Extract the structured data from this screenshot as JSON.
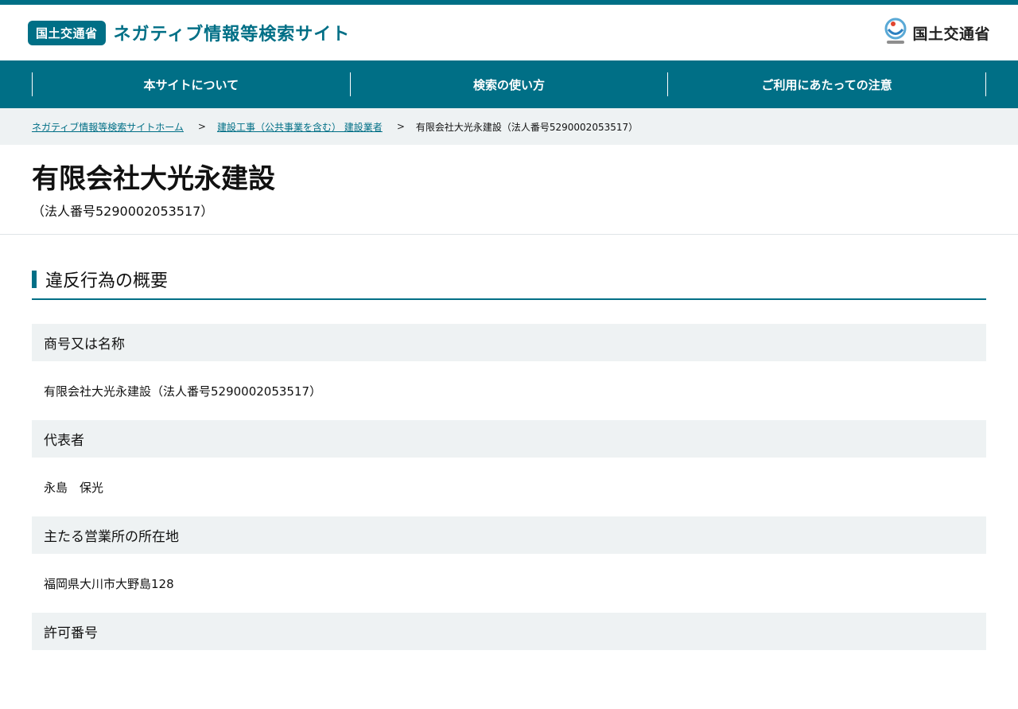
{
  "header": {
    "badge": "国土交通省",
    "site_title": "ネガティブ情報等検索サイト",
    "ministry_name": "国土交通省",
    "brand_color": "#006f86"
  },
  "nav": {
    "items": [
      {
        "label": "本サイトについて"
      },
      {
        "label": "検索の使い方"
      },
      {
        "label": "ご利用にあたっての注意"
      }
    ]
  },
  "breadcrumb": {
    "home": "ネガティブ情報等検索サイトホーム",
    "category": "建設工事（公共事業を含む） 建設業者",
    "current": "有限会社大光永建設（法人番号5290002053517）",
    "separator": ">"
  },
  "page": {
    "title": "有限会社大光永建設",
    "subtitle": "（法人番号5290002053517）"
  },
  "section": {
    "heading": "違反行為の概要",
    "fields": [
      {
        "label": "商号又は名称",
        "value": "有限会社大光永建設（法人番号5290002053517）"
      },
      {
        "label": "代表者",
        "value": "永島　保光"
      },
      {
        "label": "主たる営業所の所在地",
        "value": "福岡県大川市大野島128"
      },
      {
        "label": "許可番号",
        "value": ""
      }
    ]
  },
  "icons": {
    "ministry_logo": "mlit-logo-icon"
  }
}
